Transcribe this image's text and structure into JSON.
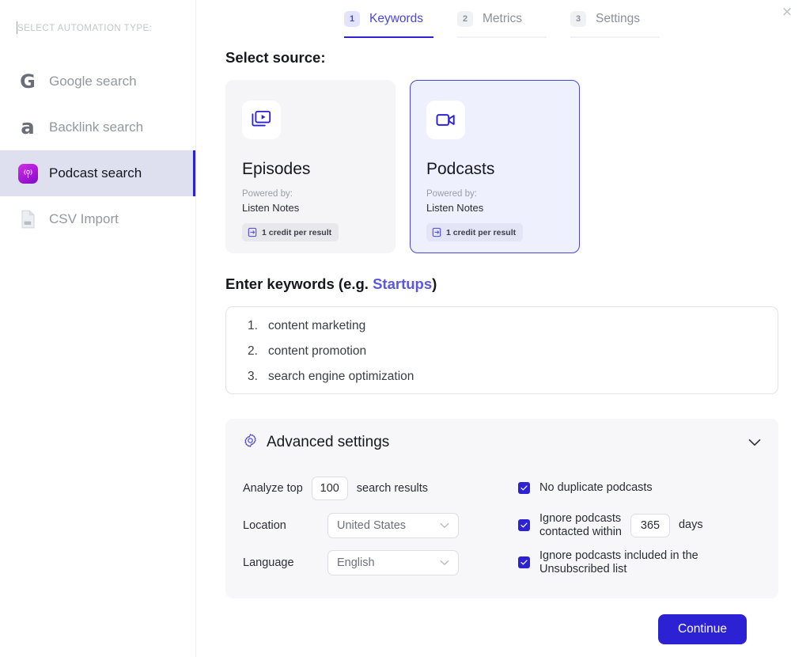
{
  "sidebar": {
    "title": "SELECT AUTOMATION TYPE:",
    "items": [
      {
        "label": "Google search",
        "icon": "google-g-icon",
        "selected": false
      },
      {
        "label": "Backlink search",
        "icon": "ahrefs-a-icon",
        "selected": false
      },
      {
        "label": "Podcast search",
        "icon": "podcast-icon",
        "selected": true
      },
      {
        "label": "CSV Import",
        "icon": "csv-file-icon",
        "selected": false
      }
    ]
  },
  "close_label": "×",
  "tabs": [
    {
      "number": "1",
      "label": "Keywords",
      "active": true
    },
    {
      "number": "2",
      "label": "Metrics",
      "active": false
    },
    {
      "number": "3",
      "label": "Settings",
      "active": false
    }
  ],
  "source": {
    "heading": "Select source:",
    "cards": [
      {
        "title": "Episodes",
        "powered_label": "Powered by:",
        "provider": "Listen Notes",
        "credit": "1 credit per result",
        "icon": "episodes-video-stack-icon",
        "selected": false
      },
      {
        "title": "Podcasts",
        "powered_label": "Powered by:",
        "provider": "Listen Notes",
        "credit": "1 credit per result",
        "icon": "podcasts-video-camera-icon",
        "selected": true
      }
    ]
  },
  "keywords": {
    "heading_prefix": "Enter keywords (e.g. ",
    "heading_example": "Startups",
    "heading_suffix": ")",
    "items": [
      {
        "num": "1.",
        "text": "content marketing"
      },
      {
        "num": "2.",
        "text": "content promotion"
      },
      {
        "num": "3.",
        "text": "search engine optimization"
      }
    ]
  },
  "advanced": {
    "title": "Advanced settings",
    "gear_icon": "gear-icon",
    "chevron_icon": "chevron-down-icon",
    "analyze_top_label": "Analyze top",
    "analyze_top_value": "100",
    "search_results_label": "search results",
    "location_label": "Location",
    "location_value": "United States",
    "language_label": "Language",
    "language_value": "English",
    "no_duplicate_label": "No duplicate podcasts",
    "no_duplicate_checked": true,
    "ignore_contacted_label": "Ignore podcasts\ncontacted within",
    "ignore_contacted_line1": "Ignore podcasts",
    "ignore_contacted_line2": "contacted within",
    "ignore_contacted_checked": true,
    "days_value": "365",
    "days_label": "days",
    "ignore_unsub_line1": "Ignore podcasts included in the",
    "ignore_unsub_line2": "Unsubscribed list",
    "ignore_unsub_checked": true
  },
  "footer": {
    "continue_label": "Continue"
  },
  "colors": {
    "accent": "#2d21d4",
    "accent_light": "#4b47d6",
    "selected_card_bg": "#eff0fe",
    "selected_nav_bg": "#dfe0ef",
    "panel_bg": "#f7f7f9",
    "card_bg": "#f5f5f7"
  }
}
